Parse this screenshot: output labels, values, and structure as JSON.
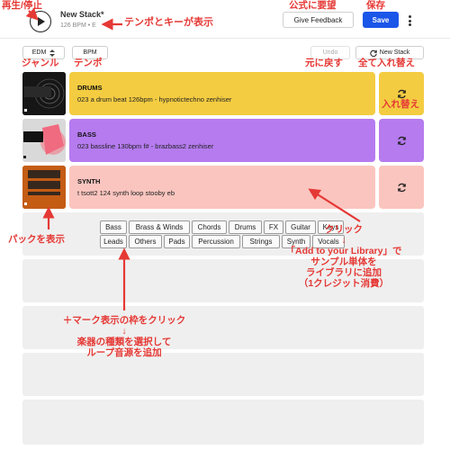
{
  "header": {
    "stack_title": "New Stack*",
    "stack_meta": "126 BPM • E",
    "feedback_label": "Give Feedback",
    "save_label": "Save"
  },
  "toolbar": {
    "genre_value": "EDM",
    "bpm_label": "BPM",
    "undo_label": "Undo",
    "new_stack_label": "New Stack"
  },
  "tracks": [
    {
      "name": "DRUMS",
      "sample": "023 a drum beat 126bpm - hypnotictechno zenhiser",
      "color": "#f4cc41",
      "art": "HYPNOTIC TECHNO"
    },
    {
      "name": "BASS",
      "sample": "023 bassline 130bpm f# - brazbass2 zenhiser",
      "color": "#b57bef",
      "art": "BRAZILIAN BASS 2"
    },
    {
      "name": "SYNTH",
      "sample": "t tsott2 124 synth loop stooby eb",
      "color": "#fbc5bf",
      "art": "TRX TRX"
    }
  ],
  "instruments": {
    "row1": [
      "Bass",
      "Brass & Winds",
      "Chords",
      "Drums",
      "FX",
      "Guitar",
      "Keys"
    ],
    "row2": [
      "Leads",
      "Others",
      "Pads",
      "Percussion",
      "Strings",
      "Synth",
      "Vocals"
    ]
  },
  "annotations": {
    "play_stop": "再生/停止",
    "tempo_key": "テンポとキーが表示",
    "feedback": "公式に要望",
    "save": "保存",
    "genre": "ジャンル",
    "tempo": "テンポ",
    "undo": "元に戻す",
    "replace_all": "全て入れ替え",
    "replace": "入れ替え",
    "show_pack": "パックを表示",
    "click": "クリック",
    "arrow_down": "↓",
    "library_line1": "「Add to your Library」で",
    "library_line2": "サンプル単体を",
    "library_line3": "ライブラリに追加",
    "library_line4": "（1クレジット消費）",
    "plus_line1": "＋マーク表示の枠をクリック",
    "plus_line2": "楽器の種類を選択して",
    "plus_line3": "ループ音源を追加"
  },
  "colors": {
    "accent_blue": "#1a56e8",
    "annotation_red": "#e53935",
    "drums": "#f4cc41",
    "bass": "#b57bef",
    "synth": "#fbc5bf",
    "slot_bg": "#efefef"
  }
}
